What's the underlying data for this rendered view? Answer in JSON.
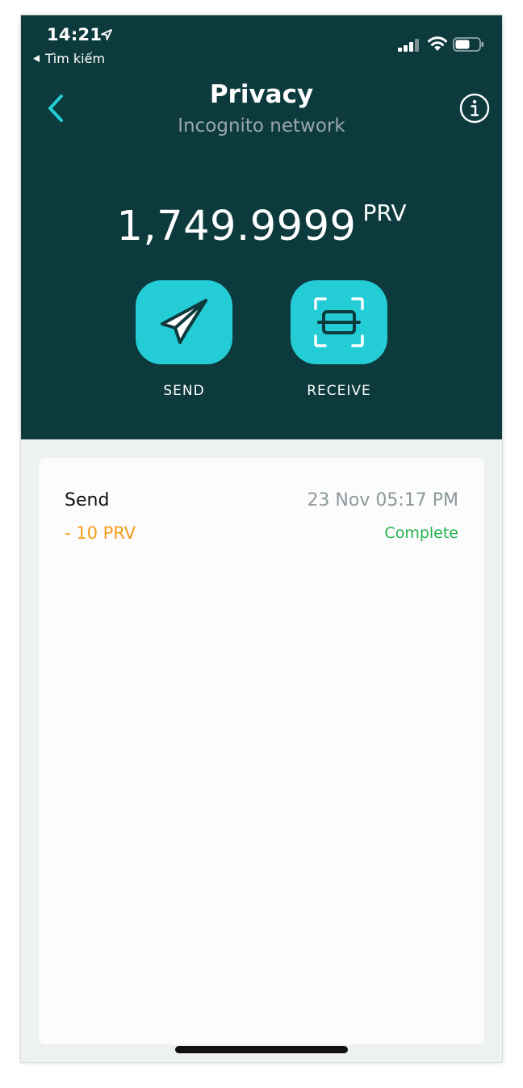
{
  "status_bar": {
    "time": "14:21",
    "back_app_label": "Tìm kiếm",
    "icons": [
      "location-arrow-icon",
      "signal-icon",
      "wifi-icon",
      "battery-icon"
    ]
  },
  "nav": {
    "title": "Privacy",
    "subtitle": "Incognito network",
    "back_icon": "chevron-left-icon",
    "info_icon": "info-icon"
  },
  "balance": {
    "amount": "1,749.9999",
    "unit": "PRV"
  },
  "actions": {
    "send_label": "SEND",
    "receive_label": "RECEIVE",
    "send_icon": "paper-plane-icon",
    "receive_icon": "scan-qr-icon"
  },
  "transactions": [
    {
      "type": "Send",
      "date": "23 Nov 05:17 PM",
      "amount": "- 10 PRV",
      "status": "Complete"
    }
  ],
  "colors": {
    "header_bg": "#0c3a3d",
    "accent": "#24cdd6",
    "amount_negative": "#f59c1d",
    "status_complete": "#24b24e",
    "muted": "#8c989b"
  }
}
